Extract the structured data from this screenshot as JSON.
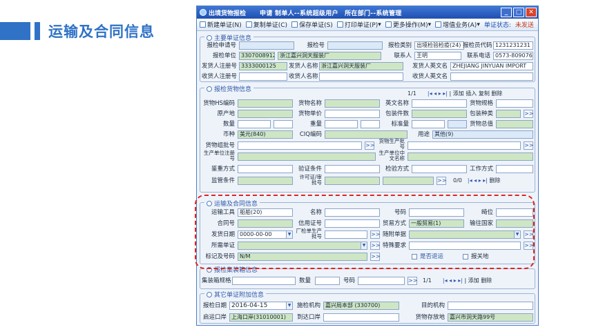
{
  "heading": {
    "title": "运输及合同信息"
  },
  "window": {
    "title": "出境货物报检",
    "info": "申请 制单人--系统超级用户　所在部门--系统管理"
  },
  "toolbar": {
    "new": "新建单证(N)",
    "copy": "复制单证(C)",
    "save": "保存单证(S)",
    "print": "打印单证(P)",
    "more_ops": "更多操作(M)",
    "value_added": "增值业务(A)",
    "status_label": "单证状态:",
    "status_value": "未发送"
  },
  "main": {
    "section_title": "主要单证信息",
    "apply_no_label": "报检申请号",
    "apply_no": "",
    "insp_no_label": "报检号",
    "insp_no": "",
    "insp_type_label": "报检类别",
    "insp_type": "出境检验检疫(24)",
    "agent_code_label": "报检员代码",
    "agent_code": "1231231231",
    "unit_label": "报检单位",
    "unit_code": "3307008912",
    "unit_name": "浙江嘉兴洞天服装厂",
    "contact_label": "联系人",
    "contact": "王明",
    "phone_label": "联系电话",
    "phone": "0573-80907698",
    "sender_reg_label": "发货人注册号",
    "sender_reg": "3333000125",
    "sender_name_label": "发货人名称",
    "sender_name": "浙江嘉兴洞天服装厂",
    "sender_en_label": "发货人英文名",
    "sender_en": "ZHEJIANG JINYUAN IMPORT",
    "receiver_reg_label": "收货人注册号",
    "receiver_reg": "",
    "receiver_name_label": "收货人名称",
    "receiver_name": "",
    "receiver_en_label": "收货人英文名",
    "receiver_en": ""
  },
  "goods": {
    "section_title": "报检货物信息",
    "pager": "1/1",
    "add": "添加",
    "insert": "插入",
    "copy": "复制",
    "delete": "删除",
    "hs_label": "货物HS编码",
    "name_label": "货物名称",
    "en_name_label": "英文名称",
    "spec_label": "货物规格",
    "origin_label": "原产地",
    "unit_price_label": "货物单价",
    "pack_count_label": "包装件数",
    "pack_type_label": "包装种类",
    "qty_label": "数量",
    "weight_label": "重量",
    "std_qty_label": "标准量",
    "total_label": "货物总值",
    "currency_label": "币种",
    "currency": "美元(840)",
    "ciq_label": "CIQ编码",
    "use_label": "用途",
    "use": "其他(9)",
    "batch_label": "货物组批号",
    "batch_prod_label": "货物生产批号",
    "prod_reg_label": "生产单位注册号",
    "prod_cn_label": "生产单位中文名称",
    "appraise_label": "鉴重方式",
    "verify_label": "验证条件",
    "insp_method_label": "检验方式",
    "craft_label": "工作方式",
    "supervise_label": "监管条件",
    "license_label": "许可证/审批号",
    "pager2": "0/0",
    "delete2": "删除"
  },
  "transport": {
    "section_title": "运输及合同信息",
    "tool_label": "运输工具",
    "tool_value": "船舶(20)",
    "name_label": "名称",
    "name": "",
    "number_label": "号码",
    "number": "",
    "berth_label": "畸位",
    "berth": "",
    "contract_label": "合同号",
    "contract": "",
    "lc_label": "信用证号",
    "lc": "",
    "trade_label": "贸易方式",
    "trade_value": "一般贸易(1)",
    "dest_label": "输往国家",
    "dest": "",
    "ship_date_label": "发货日期",
    "ship_date": "0000-00-00",
    "factory_batch_label": "厂检单生产批号",
    "factory_batch": "",
    "attached_label": "随附单据",
    "attached": "",
    "docs_label": "所需单证",
    "docs": "",
    "special_label": "特殊要求",
    "special": "",
    "mark_label": "标记及号码",
    "mark": "N/M",
    "return_label": "是否退运",
    "customs_label": "报关地"
  },
  "container": {
    "section_title": "报检集装箱信息",
    "spec_label": "集装箱规格",
    "spec": "",
    "qty_label": "数量",
    "qty": "",
    "no_label": "号码",
    "no": "",
    "pager": "1/1",
    "add": "添加",
    "delete": "删除"
  },
  "extra": {
    "section_title": "其它单证附加信息",
    "insp_date_label": "报检日期",
    "insp_date": "2016-04-15",
    "org_label": "施检机构",
    "org": "嘉兴局本部 (330700)",
    "dest_org_label": "目的机构",
    "dest_org": "",
    "port_label": "启运口岸",
    "port": "上海口岸(31010001)",
    "arrive_label": "到达口岸",
    "arrive": "",
    "storage_label": "货物存放地",
    "storage": "嘉兴市洞天路99号"
  }
}
